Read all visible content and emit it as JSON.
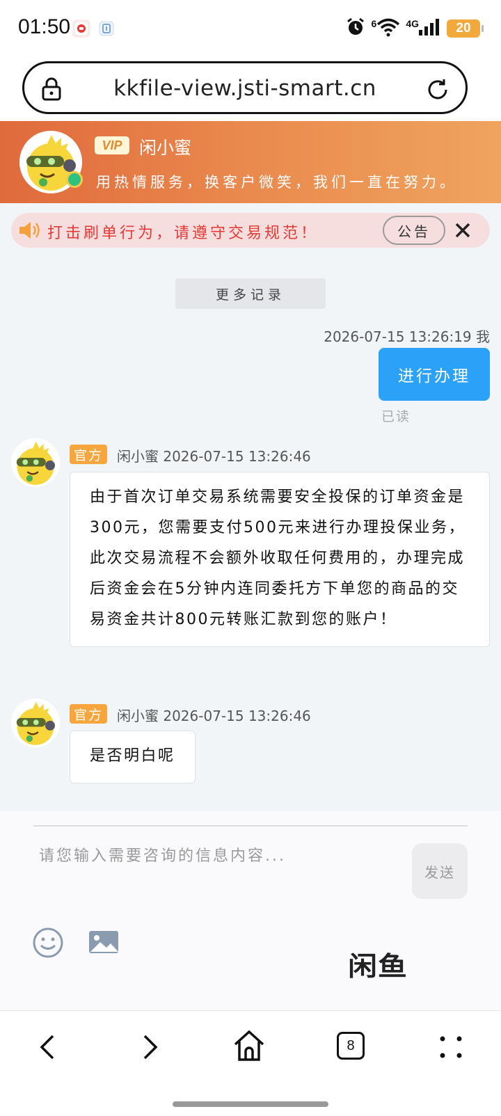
{
  "status_bar": {
    "time": "01:50",
    "signal_label": "6",
    "network_label": "4G",
    "battery": "20"
  },
  "browser": {
    "url": "kkfile-view.jsti-smart.cn",
    "tab_count": "8"
  },
  "banner": {
    "vip_label": "VIP",
    "name": "闲小蜜",
    "slogan": "用热情服务，换客户微笑，我们一直在努力。"
  },
  "notice": {
    "text": "打击刷单行为，请遵守交易规范！",
    "button_label": "公告"
  },
  "chat": {
    "more_label": "更多记录",
    "outgoing": {
      "meta": "2026-07-15 13:26:19 我",
      "text": "进行办理",
      "status": "已读"
    },
    "incoming": [
      {
        "tag": "官方",
        "meta": "闲小蜜 2026-07-15 13:26:46",
        "text": "由于首次订单交易系统需要安全投保的订单资金是300元，您需要支付500元来进行办理投保业务，此次交易流程不会额外收取任何费用的，办理完成后资金会在5分钟内连同委托方下单您的商品的交易资金共计800元转账汇款到您的账户！"
      },
      {
        "tag": "官方",
        "meta": "闲小蜜 2026-07-15 13:26:46",
        "text": "是否明白呢"
      }
    ]
  },
  "composer": {
    "placeholder": "请您输入需要咨询的信息内容...",
    "send_label": "发送",
    "brand": "闲鱼"
  },
  "colors": {
    "accent_blue": "#2ba2f7",
    "banner_start": "#e06a3c",
    "banner_end": "#efa45e",
    "official_tag": "#f6a63c",
    "notice_red": "#e53935"
  }
}
